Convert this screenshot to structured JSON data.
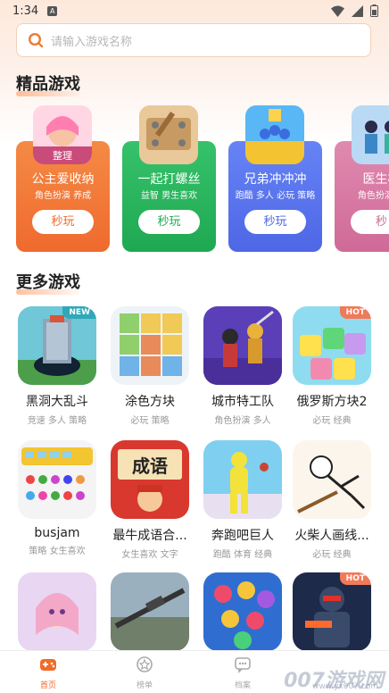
{
  "status": {
    "time": "1:34",
    "a_badge": "A"
  },
  "search": {
    "placeholder": "请输入游戏名称"
  },
  "featured": {
    "title": "精品游戏",
    "items": [
      {
        "name": "公主爱收纳",
        "tags": "角色扮演 养成",
        "button": "秒玩",
        "color": "#f2773a"
      },
      {
        "name": "一起打螺丝",
        "tags": "益智 男生喜欢",
        "button": "秒玩",
        "color": "#25b25c"
      },
      {
        "name": "兄弟冲冲冲",
        "tags": "跑酷 多人 必玩 策略",
        "button": "秒玩",
        "color": "#5670ec"
      },
      {
        "name": "医生模",
        "tags": "角色扮演 女",
        "button": "秒",
        "color": "#d77aa3"
      }
    ]
  },
  "more": {
    "title": "更多游戏",
    "games": [
      {
        "title": "黑洞大乱斗",
        "tags": "竞速 多人 策略",
        "badge": "NEW",
        "badge_color": "#2fa8b8"
      },
      {
        "title": "涂色方块",
        "tags": "必玩 策略",
        "badge": "",
        "badge_color": ""
      },
      {
        "title": "城市特工队",
        "tags": "角色扮演 多人",
        "badge": "",
        "badge_color": ""
      },
      {
        "title": "俄罗斯方块2",
        "tags": "必玩 经典",
        "badge": "HOT",
        "badge_color": "#f07a5a"
      },
      {
        "title": "busjam",
        "tags": "策略 女生喜欢",
        "badge": "",
        "badge_color": ""
      },
      {
        "title": "最牛成语合...",
        "tags": "女生喜欢 文字",
        "badge": "",
        "badge_color": ""
      },
      {
        "title": "奔跑吧巨人",
        "tags": "跑酷 体育 经典",
        "badge": "",
        "badge_color": ""
      },
      {
        "title": "火柴人画线...",
        "tags": "必玩 经典",
        "badge": "",
        "badge_color": ""
      },
      {
        "title": "",
        "tags": "",
        "badge": "",
        "badge_color": ""
      },
      {
        "title": "",
        "tags": "",
        "badge": "",
        "badge_color": ""
      },
      {
        "title": "",
        "tags": "",
        "badge": "",
        "badge_color": ""
      },
      {
        "title": "",
        "tags": "",
        "badge": "HOT",
        "badge_color": "#f07a5a"
      }
    ]
  },
  "tabs": [
    {
      "label": "首页",
      "active": true
    },
    {
      "label": "榜单",
      "active": false
    },
    {
      "label": "档案",
      "active": false
    }
  ],
  "watermark": {
    "text": "007游戏网",
    "url": "www.yx007.com"
  },
  "colors": {
    "accent": "#f06b2a",
    "search_icon": "#f07a2e"
  }
}
